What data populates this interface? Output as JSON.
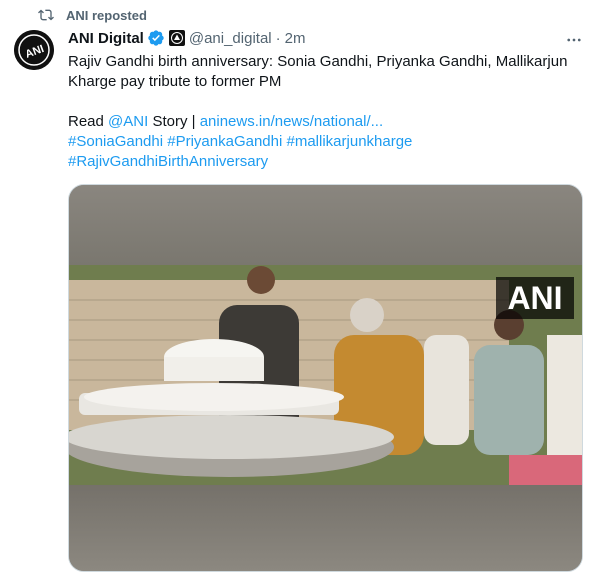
{
  "repost": {
    "label": "ANI reposted"
  },
  "author": {
    "name": "ANI Digital",
    "handle": "@ani_digital",
    "separator": "·",
    "time": "2m",
    "avatar_text": "ANI"
  },
  "tweet": {
    "text": "Rajiv Gandhi birth anniversary: Sonia Gandhi, Priyanka Gandhi, Mallikarjun Kharge pay tribute to former PM",
    "read_prefix": "Read",
    "mention": "@ANI",
    "story_label": "Story |",
    "url": "aninews.in/news/national/...",
    "hashtags": [
      "#SoniaGandhi",
      "#PriyankaGandhi",
      "#mallikarjunkharge",
      "#RajivGandhiBirthAnniversary"
    ]
  },
  "media": {
    "watermark": "ANI"
  },
  "colors": {
    "link": "#1d9bf0",
    "secondary": "#536471",
    "verified": "#1d9bf0"
  },
  "icons": {
    "repost": "repost-icon",
    "verified": "verified-badge-icon",
    "affiliate": "affiliate-badge-icon",
    "more": "more-icon"
  }
}
